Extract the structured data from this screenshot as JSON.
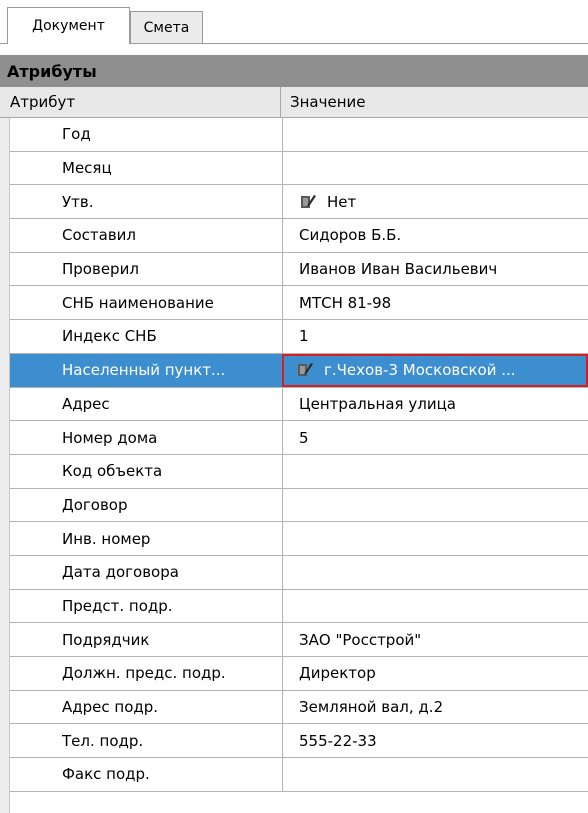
{
  "tabs": [
    {
      "label": "Документ",
      "active": true
    },
    {
      "label": "Смета",
      "active": false
    }
  ],
  "group_header": "Атрибуты",
  "columns": {
    "attribute": "Атрибут",
    "value": "Значение"
  },
  "rows": [
    {
      "attr": "Год",
      "value": ""
    },
    {
      "attr": "Месяц",
      "value": ""
    },
    {
      "attr": "Утв.",
      "value": "Нет",
      "icon": "catalog-icon"
    },
    {
      "attr": "Составил",
      "value": "Сидоров Б.Б."
    },
    {
      "attr": "Проверил",
      "value": "Иванов Иван Васильевич"
    },
    {
      "attr": "СНБ наименование",
      "value": "МТСН 81-98"
    },
    {
      "attr": "Индекс СНБ",
      "value": "1"
    },
    {
      "attr": "Населенный пункт...",
      "value": "г.Чехов-3 Московской ...",
      "icon": "catalog-icon",
      "selected": true
    },
    {
      "attr": "Адрес",
      "value": "Центральная улица"
    },
    {
      "attr": "Номер дома",
      "value": "5"
    },
    {
      "attr": "Код объекта",
      "value": ""
    },
    {
      "attr": "Договор",
      "value": ""
    },
    {
      "attr": "Инв. номер",
      "value": ""
    },
    {
      "attr": "Дата договора",
      "value": ""
    },
    {
      "attr": "Предст. подр.",
      "value": ""
    },
    {
      "attr": "Подрядчик",
      "value": "ЗАО \"Росстрой\""
    },
    {
      "attr": "Должн. предс. подр.",
      "value": "Директор"
    },
    {
      "attr": "Адрес подр.",
      "value": "Земляной вал, д.2"
    },
    {
      "attr": "Тел. подр.",
      "value": "555-22-33"
    },
    {
      "attr": "Факс подр.",
      "value": ""
    }
  ],
  "colors": {
    "selection": "#3d8ecf",
    "focus_border": "#d42020",
    "group_header": "#8f8f8f"
  }
}
